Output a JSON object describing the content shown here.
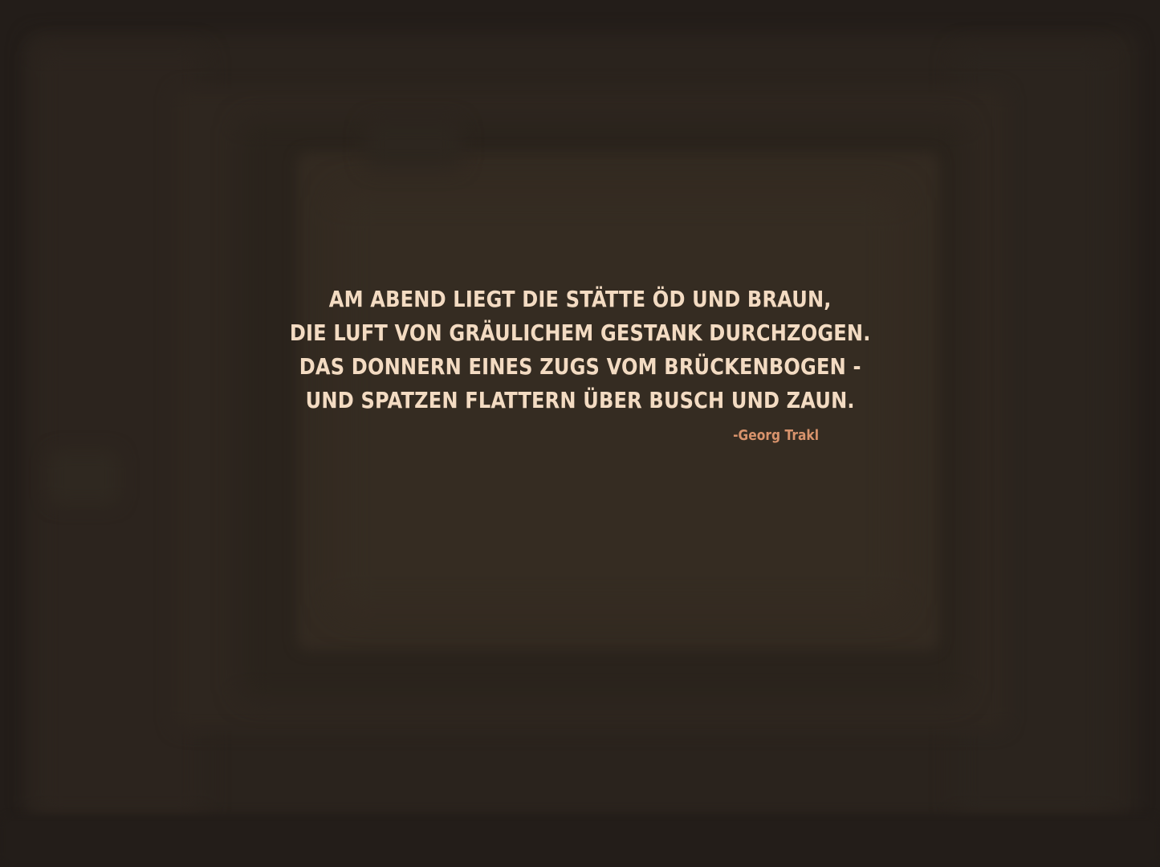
{
  "quote": {
    "lines": [
      "AM ABEND LIEGT DIE STÄTTE ÖD UND BRAUN,",
      "DIE LUFT VON GRÄULICHEM GESTANK DURCHZOGEN.",
      "DAS DONNERN EINES ZUGS VOM BRÜCKENBOGEN -",
      "UND SPATZEN FLATTERN ÜBER BUSCH UND ZAUN."
    ],
    "author": "-Georg Trakl"
  },
  "colors": {
    "background": "#231d19",
    "quote_text": "#f3dbc2",
    "author_text": "#d8936c"
  }
}
